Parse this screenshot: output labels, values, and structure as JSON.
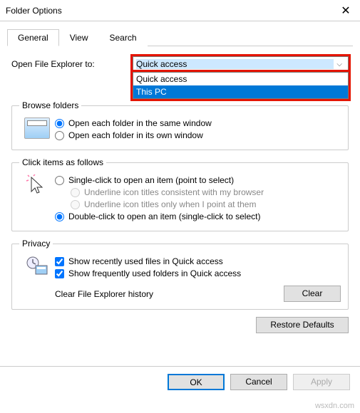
{
  "window": {
    "title": "Folder Options"
  },
  "tabs": {
    "general": "General",
    "view": "View",
    "search": "Search"
  },
  "open_to": {
    "label": "Open File Explorer to:",
    "selected": "Quick access",
    "options": [
      "Quick access",
      "This PC"
    ]
  },
  "browse": {
    "legend": "Browse folders",
    "opt_same": "Open each folder in the same window",
    "opt_own": "Open each folder in its own window"
  },
  "click": {
    "legend": "Click items as follows",
    "single": "Single-click to open an item (point to select)",
    "underline_browser": "Underline icon titles consistent with my browser",
    "underline_point": "Underline icon titles only when I point at them",
    "double": "Double-click to open an item (single-click to select)"
  },
  "privacy": {
    "legend": "Privacy",
    "recent_files": "Show recently used files in Quick access",
    "freq_folders": "Show frequently used folders in Quick access",
    "clear_label": "Clear File Explorer history",
    "clear_btn": "Clear"
  },
  "buttons": {
    "restore": "Restore Defaults",
    "ok": "OK",
    "cancel": "Cancel",
    "apply": "Apply"
  },
  "watermark": "wsxdn.com"
}
